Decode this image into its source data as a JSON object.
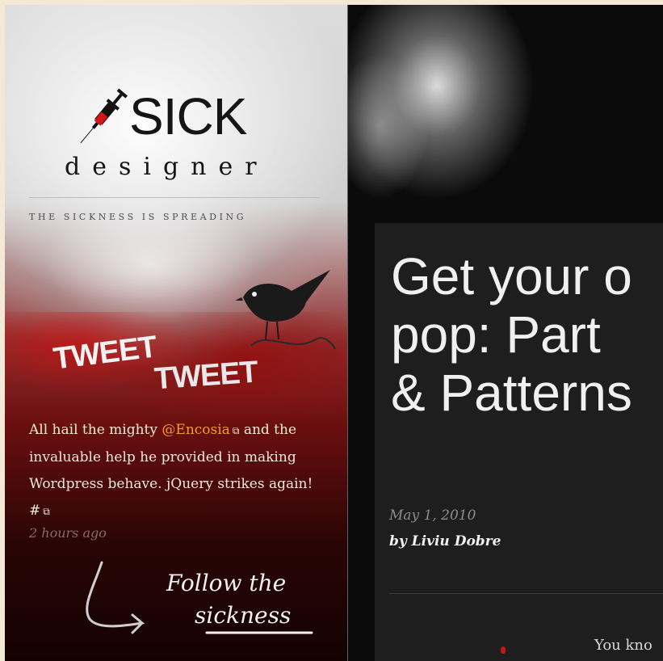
{
  "site": {
    "logo_sick": "SICK",
    "logo_designer": "designer",
    "tagline": "THE SICKNESS IS SPREADING"
  },
  "tweet": {
    "title_word1": "TWEET",
    "title_word2": "TWEET",
    "text_before": "All hail the mighty",
    "handle": "@Encosia",
    "text_after": "and the invaluable help he provided in making Wordpress behave. jQuery strikes again!",
    "hash": "#",
    "time": "2 hours ago",
    "follow_line1": "Follow the",
    "follow_line2": "sickness"
  },
  "post": {
    "title_line1": "Get your o",
    "title_line2": "pop: Part",
    "title_line3": "& Patterns",
    "date": "May 1, 2010",
    "author": "by Liviu Dobre",
    "excerpt": "You kno"
  },
  "colors": {
    "accent_handle": "#f0a020",
    "syringe_red": "#d4161c",
    "card_bg": "#1e1e1e"
  },
  "icons": {
    "syringe": "syringe-icon",
    "bird": "bird-icon",
    "external_link": "external-link-icon",
    "arrow": "hand-drawn-arrow-icon"
  }
}
